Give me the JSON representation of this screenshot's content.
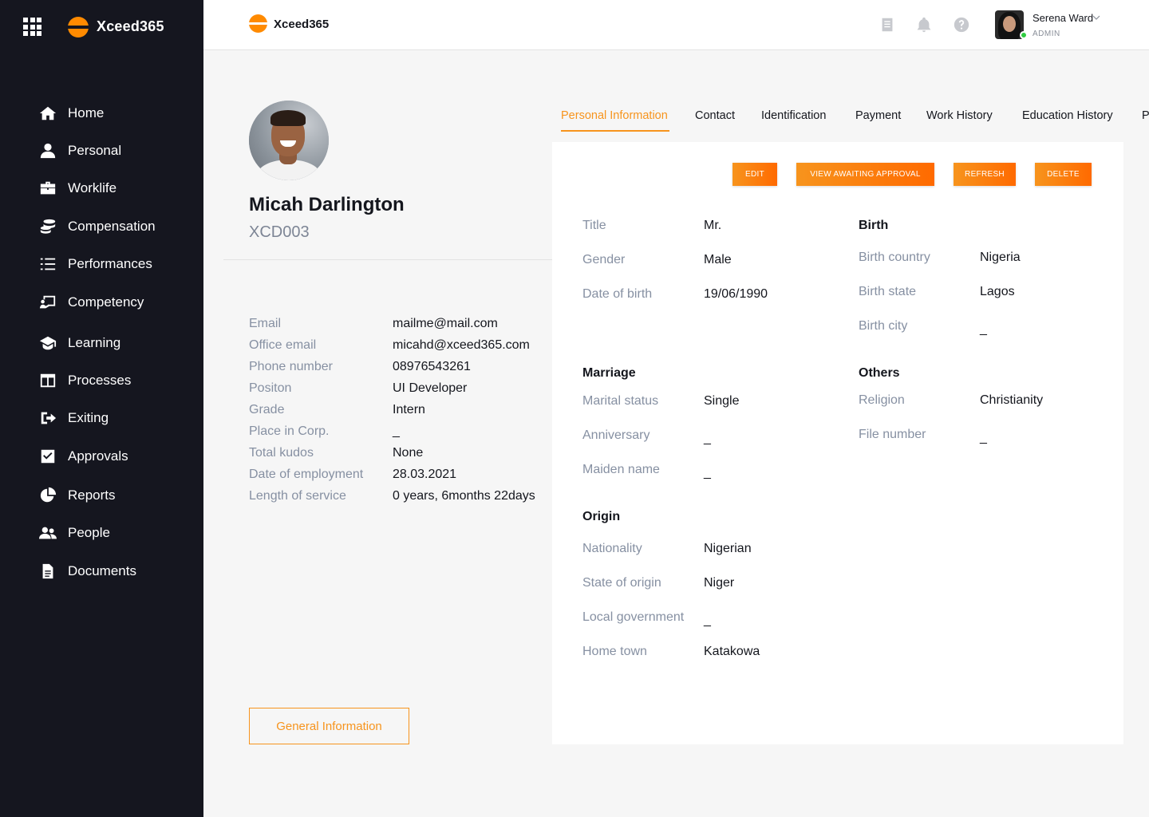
{
  "app": {
    "brand": "Xceed365"
  },
  "sidebar": {
    "items": [
      {
        "label": "Home",
        "icon": "home-icon"
      },
      {
        "label": "Personal",
        "icon": "person-icon"
      },
      {
        "label": "Worklife",
        "icon": "briefcase-icon"
      },
      {
        "label": "Compensation",
        "icon": "coins-icon"
      },
      {
        "label": "Performances",
        "icon": "list-icon"
      },
      {
        "label": "Competency",
        "icon": "presentation-icon"
      },
      {
        "label": "Learning",
        "icon": "graduation-cap-icon"
      },
      {
        "label": "Processes",
        "icon": "columns-icon"
      },
      {
        "label": "Exiting",
        "icon": "sign-out-icon"
      },
      {
        "label": "Approvals",
        "icon": "checkbox-icon"
      },
      {
        "label": "Reports",
        "icon": "pie-chart-icon"
      },
      {
        "label": "People",
        "icon": "users-icon"
      },
      {
        "label": "Documents",
        "icon": "document-icon"
      }
    ]
  },
  "topbar": {
    "brand": "Xceed365",
    "user": {
      "name": "Serena Ward",
      "role": "ADMIN"
    }
  },
  "profile": {
    "name": "Micah Darlington",
    "id": "XCD003",
    "details": [
      {
        "label": "Email",
        "value": "mailme@mail.com"
      },
      {
        "label": "Office email",
        "value": "micahd@xceed365.com"
      },
      {
        "label": "Phone number",
        "value": "08976543261"
      },
      {
        "label": "Positon",
        "value": "UI Developer"
      },
      {
        "label": "Grade",
        "value": "Intern"
      },
      {
        "label": "Place in Corp.",
        "value": "_"
      },
      {
        "label": "Total kudos",
        "value": "None"
      },
      {
        "label": "Date of employment",
        "value": "28.03.2021"
      },
      {
        "label": "Length of service",
        "value": "0 years, 6months 22days"
      }
    ],
    "general_button": "General Information"
  },
  "tabs": [
    "Personal Information",
    "Contact",
    "Identification",
    "Payment",
    "Work History",
    "Education History",
    "P"
  ],
  "actions": {
    "edit": "EDIT",
    "view": "VIEW AWAITING APPROVAL",
    "refresh": "REFRESH",
    "delete": "DELETE"
  },
  "personal": {
    "basic": [
      {
        "label": "Title",
        "value": "Mr."
      },
      {
        "label": "Gender",
        "value": "Male"
      },
      {
        "label": "Date of birth",
        "value": "19/06/1990"
      }
    ],
    "birth": {
      "heading": "Birth",
      "fields": [
        {
          "label": "Birth country",
          "value": "Nigeria"
        },
        {
          "label": "Birth state",
          "value": "Lagos"
        },
        {
          "label": "Birth city",
          "value": "_"
        }
      ]
    },
    "marriage": {
      "heading": "Marriage",
      "fields": [
        {
          "label": "Marital status",
          "value": "Single"
        },
        {
          "label": "Anniversary",
          "value": "_"
        },
        {
          "label": "Maiden name",
          "value": "_"
        }
      ]
    },
    "others": {
      "heading": "Others",
      "fields": [
        {
          "label": "Religion",
          "value": "Christianity"
        },
        {
          "label": "File number",
          "value": "_"
        }
      ]
    },
    "origin": {
      "heading": "Origin",
      "fields": [
        {
          "label": "Nationality",
          "value": "Nigerian"
        },
        {
          "label": "State of origin",
          "value": "Niger"
        },
        {
          "label": "Local government",
          "value": "_"
        },
        {
          "label": "Home town",
          "value": "Katakowa"
        }
      ]
    }
  },
  "colors": {
    "sidebar": "#15161f",
    "accent": "#f7941d",
    "muted_label": "#8690a2"
  }
}
